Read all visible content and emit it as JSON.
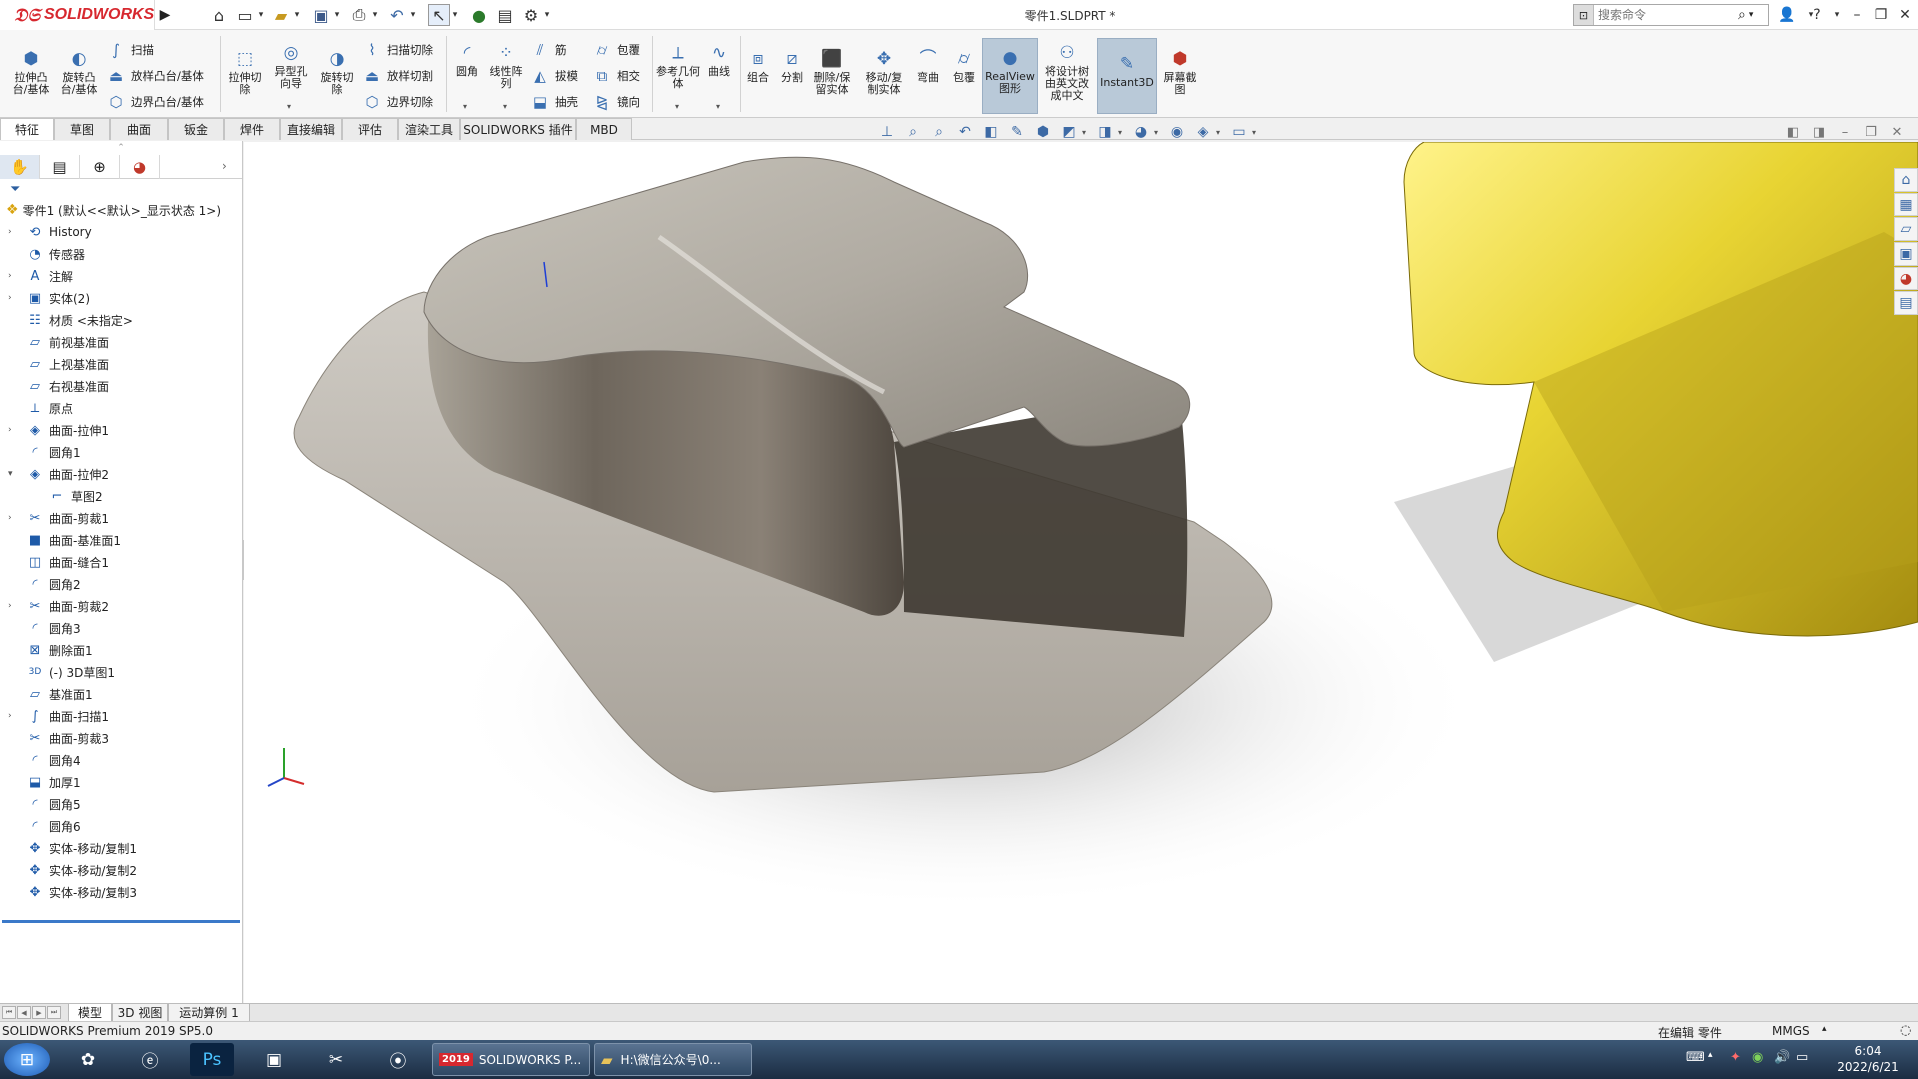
{
  "app": {
    "logo_text": "SOLIDWORKS",
    "doc_title": "零件1.SLDPRT *",
    "brand_color": "#d7282f",
    "accent_color": "#3a6fb0"
  },
  "search": {
    "placeholder": "搜索命令"
  },
  "ribbon": {
    "extrude_boss": "拉伸凸台/基体",
    "revolve_boss": "旋转凸台/基体",
    "sweep": "扫描",
    "loft": "放样凸台/基体",
    "boundary_boss": "边界凸台/基体",
    "extrude_cut": "拉伸切除",
    "hole_wizard": "异型孔向导",
    "revolve_cut": "旋转切除",
    "swept_cut": "扫描切除",
    "lofted_cut": "放样切割",
    "boundary_cut": "边界切除",
    "fillet": "圆角",
    "linear_pattern": "线性阵列",
    "rib": "筋",
    "draft": "拔模",
    "shell": "抽壳",
    "wrap": "包覆",
    "intersect": "相交",
    "mirror": "镜向",
    "ref_geometry": "参考几何体",
    "curves": "曲线",
    "combine": "组合",
    "split": "分割",
    "delete_keep": "删除/保留实体",
    "move_copy": "移动/复制实体",
    "flex": "弯曲",
    "wrap2": "包覆",
    "realview": "RealView图形",
    "translate": "将设计树由英文改成中文",
    "instant3d": "Instant3D",
    "screenshot": "屏幕截图"
  },
  "tabs": [
    "特征",
    "草图",
    "曲面",
    "钣金",
    "焊件",
    "直接编辑",
    "评估",
    "渲染工具",
    "SOLIDWORKS 插件",
    "MBD"
  ],
  "tree": {
    "root": "零件1 (默认<<默认>_显示状态 1>)",
    "items": [
      {
        "label": "History",
        "icon": "history-icon"
      },
      {
        "label": "传感器",
        "icon": "sensor-icon"
      },
      {
        "label": "注解",
        "icon": "annotation-icon"
      },
      {
        "label": "实体(2)",
        "icon": "solid-bodies-icon"
      },
      {
        "label": "材质 <未指定>",
        "icon": "material-icon"
      },
      {
        "label": "前视基准面",
        "icon": "plane-icon"
      },
      {
        "label": "上视基准面",
        "icon": "plane-icon"
      },
      {
        "label": "右视基准面",
        "icon": "plane-icon"
      },
      {
        "label": "原点",
        "icon": "origin-icon"
      },
      {
        "label": "曲面-拉伸1",
        "icon": "surface-extrude-icon"
      },
      {
        "label": "圆角1",
        "icon": "fillet-icon"
      },
      {
        "label": "曲面-拉伸2",
        "icon": "surface-extrude-icon"
      },
      {
        "label": "草图2",
        "icon": "sketch-icon"
      },
      {
        "label": "曲面-剪裁1",
        "icon": "surface-trim-icon"
      },
      {
        "label": "曲面-基准面1",
        "icon": "planar-surface-icon"
      },
      {
        "label": "曲面-缝合1",
        "icon": "knit-icon"
      },
      {
        "label": "圆角2",
        "icon": "fillet-icon"
      },
      {
        "label": "曲面-剪裁2",
        "icon": "surface-trim-icon"
      },
      {
        "label": "圆角3",
        "icon": "fillet-icon"
      },
      {
        "label": "删除面1",
        "icon": "delete-face-icon"
      },
      {
        "label": "(-) 3D草图1",
        "icon": "3d-sketch-icon"
      },
      {
        "label": "基准面1",
        "icon": "plane-icon"
      },
      {
        "label": "曲面-扫描1",
        "icon": "surface-sweep-icon"
      },
      {
        "label": "曲面-剪裁3",
        "icon": "surface-trim-icon"
      },
      {
        "label": "圆角4",
        "icon": "fillet-icon"
      },
      {
        "label": "加厚1",
        "icon": "thicken-icon"
      },
      {
        "label": "圆角5",
        "icon": "fillet-icon"
      },
      {
        "label": "圆角6",
        "icon": "fillet-icon"
      },
      {
        "label": "实体-移动/复制1",
        "icon": "move-copy-icon"
      },
      {
        "label": "实体-移动/复制2",
        "icon": "move-copy-icon"
      },
      {
        "label": "实体-移动/复制3",
        "icon": "move-copy-icon"
      }
    ]
  },
  "bottom_tabs": [
    "模型",
    "3D 视图",
    "运动算例 1"
  ],
  "status": {
    "left": "SOLIDWORKS Premium 2019 SP5.0",
    "edit": "在编辑 零件",
    "units": "MMGS"
  },
  "taskbar": {
    "sw_window": "SOLIDWORKS P...",
    "folder_window": "H:\\微信公众号\\0...",
    "sw_badge": "2019",
    "ps_label": "Ps",
    "time": "6:04",
    "date": "2022/6/21"
  },
  "colors": {
    "steel": "#9a948a",
    "gold": "#e8d433"
  }
}
